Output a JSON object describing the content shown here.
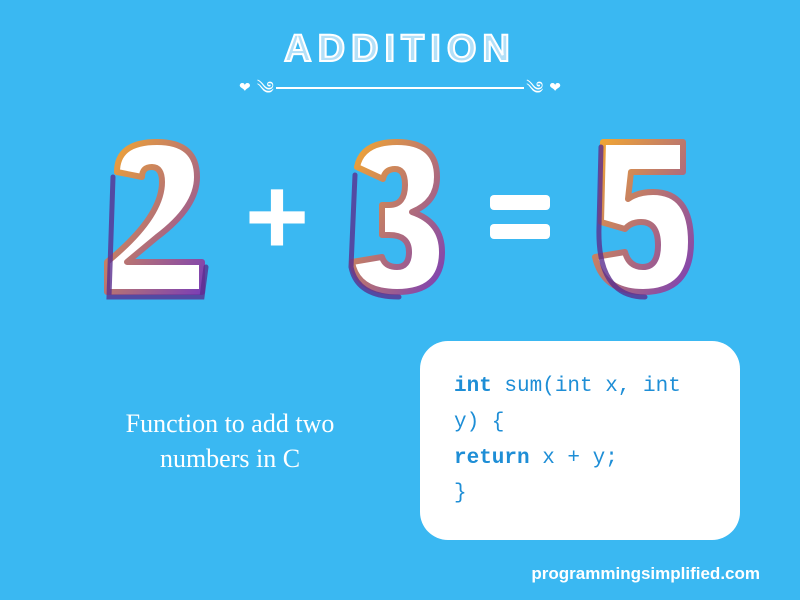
{
  "title": "ADDITION",
  "equation": {
    "left": "2",
    "operator": "+",
    "right": "3",
    "equals": "=",
    "result": "5"
  },
  "caption": "Function to add two\nnumbers in C",
  "code": {
    "line1_kw": "int",
    "line1_rest": " sum(int x, int y) {",
    "line2_indent": "  ",
    "line2_kw": "return",
    "line2_rest": " x + y;",
    "line3": "}"
  },
  "attribution": "programmingsimplified.com"
}
